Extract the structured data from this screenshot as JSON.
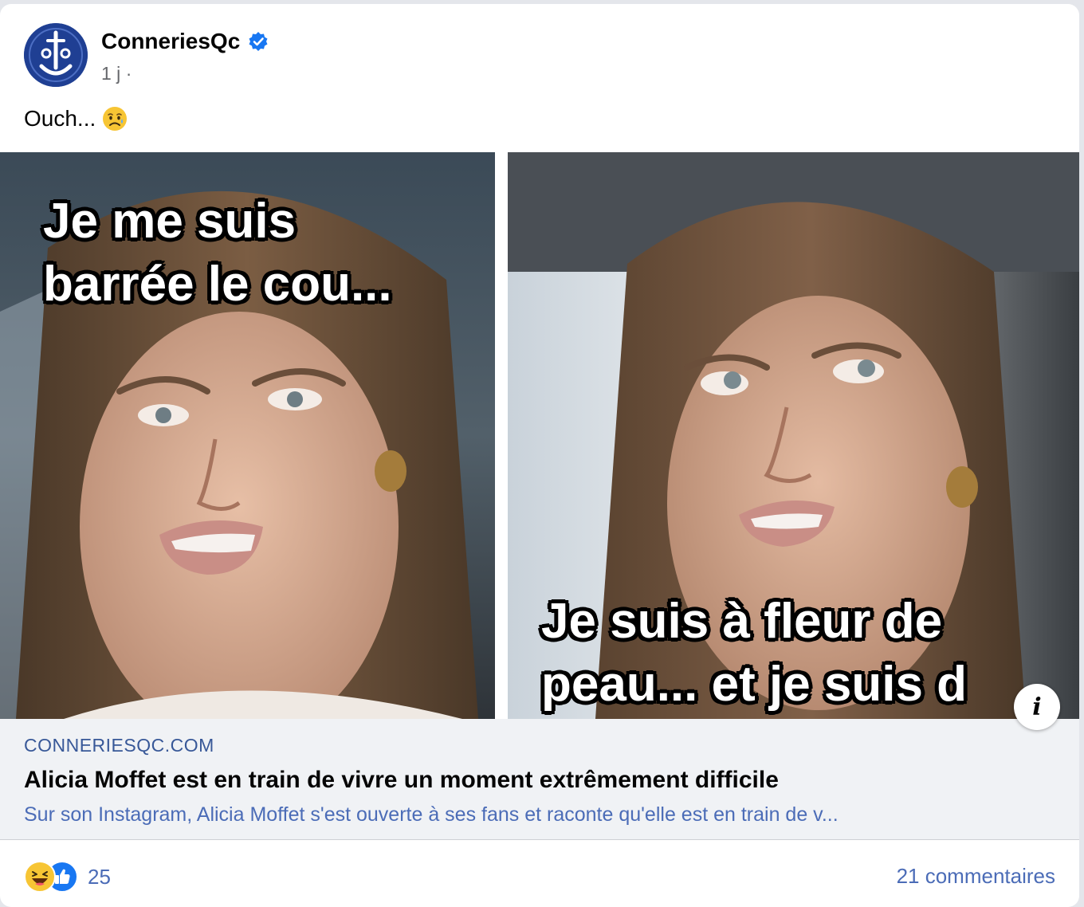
{
  "post": {
    "page_name": "ConneriesQc",
    "verified_icon": "verified-badge-icon",
    "timestamp": "1 j",
    "audience_separator": "·",
    "caption": "Ouch...",
    "caption_emoji": "sad-relieved-face-emoji"
  },
  "media": {
    "left_overlay_line1": "Je me suis",
    "left_overlay_line2": "barrée le cou...",
    "right_overlay_line1": "Je suis à fleur de",
    "right_overlay_line2": "peau... et je suis d",
    "info_label": "i"
  },
  "link_preview": {
    "domain": "CONNERIESQC.COM",
    "title": "Alicia Moffet est en train de vivre un moment extrêmement difficile",
    "description": "Sur son Instagram, Alicia Moffet s'est ouverte à ses fans et raconte qu'elle est en train de v..."
  },
  "engagement": {
    "reaction_icons": [
      "haha-reaction-icon",
      "like-reaction-icon"
    ],
    "reaction_count": "25",
    "comments": "21 commentaires"
  },
  "colors": {
    "link_blue": "#385898",
    "secondary_blue": "#4b6cb7",
    "verified_blue": "#1877f2",
    "avatar_navy": "#1f3f93"
  }
}
